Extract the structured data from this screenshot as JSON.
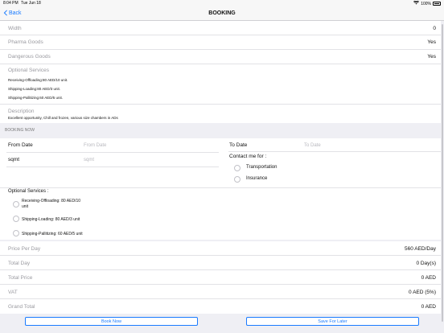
{
  "status": {
    "time": "8:04 PM",
    "date": "Tue Jun 18",
    "battery": "100%"
  },
  "nav": {
    "back": "Back",
    "title": "BOOKING"
  },
  "details": {
    "width": {
      "label": "Width",
      "value": "0"
    },
    "pharma": {
      "label": "Pharma Goods",
      "value": "Yes"
    },
    "dangerous": {
      "label": "Dangerous Goods",
      "value": "Yes"
    },
    "optional_services": {
      "label": "Optional Services",
      "items": [
        "Receiving-Offloading:80 AED/10 unit.",
        "Shipping-Loading:80 AED/3 unit.",
        "Shipping-Pallitizing:60 AED/5 unit."
      ]
    },
    "description": {
      "label": "Description",
      "text": "Excellent opportunity, Chill and frozen, various size chambers in ADs"
    }
  },
  "booking_now": {
    "header": "BOOKING NOW",
    "from_date": {
      "label": "From Date",
      "placeholder": "From Date"
    },
    "to_date": {
      "label": "To Date",
      "placeholder": "To Date"
    },
    "sqmt": {
      "label": "sqmt",
      "placeholder": "sqmt"
    },
    "contact": {
      "label": "Contact me for :",
      "options": [
        "Transportation",
        "Insurance"
      ]
    },
    "optional": {
      "label": "Optional Services :",
      "options": [
        "Receiving-Offloading: 80 AED/10",
        "unit",
        "Shipping-Loading: 80 AED/3 unit",
        "Shipping-Pallitizing: 60 AED/5 unit"
      ]
    }
  },
  "totals": {
    "price_per_day": {
      "label": "Price Per Day",
      "value": "560 AED/Day"
    },
    "total_day": {
      "label": "Total Day",
      "value": "0 Day(s)"
    },
    "total_price": {
      "label": "Total Price",
      "value": "0 AED"
    },
    "vat": {
      "label": "VAT",
      "value": "0 AED (5%)"
    },
    "grand_total": {
      "label": "Grand Total",
      "value": "0 AED"
    }
  },
  "buttons": {
    "book_now": "Book Now",
    "save_later": "Save For Later"
  },
  "colors": {
    "accent": "#1a7bff",
    "background": "#efeff4"
  }
}
